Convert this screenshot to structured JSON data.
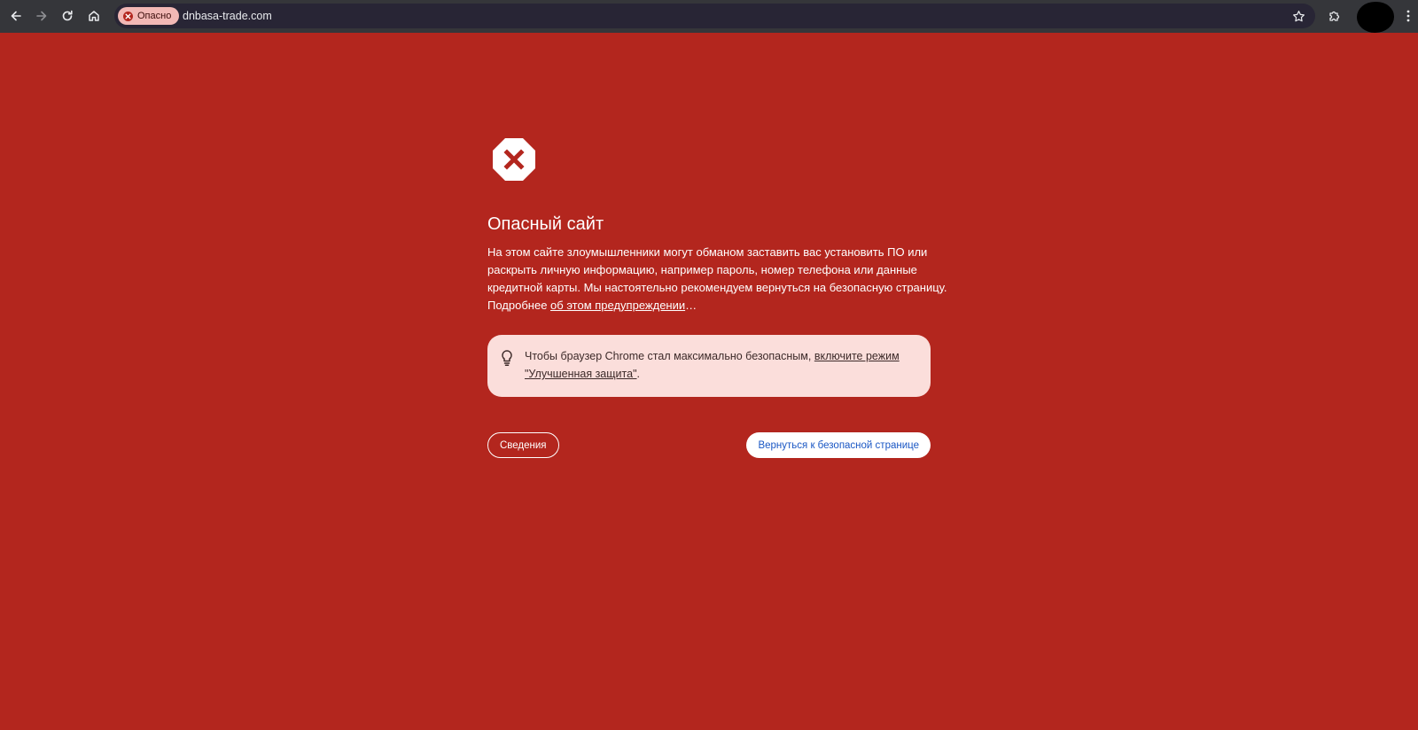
{
  "toolbar": {
    "back_icon": "arrow-left-icon",
    "forward_icon": "arrow-right-icon",
    "reload_icon": "reload-icon",
    "home_icon": "home-icon",
    "security_chip_label": "Опасно",
    "url": "dnbasa-trade.com",
    "bookmark_icon": "star-icon",
    "extensions_icon": "puzzle-icon",
    "menu_icon": "kebab-menu-icon"
  },
  "interstitial": {
    "icon": "dangerous-site-icon",
    "heading": "Опасный сайт",
    "message": {
      "line1": "На этом сайте злоумышленники могут обманом заставить вас установить ПО или",
      "line2": "раскрыть личную информацию, например пароль, номер телефона или данные",
      "line3": "кредитной карты. Мы настоятельно рекомендуем вернуться на безопасную страницу.",
      "learn_more_prefix": "Подробнее ",
      "learn_more_link": "об этом предупреждении",
      "learn_more_suffix": "…"
    },
    "promo": {
      "icon": "lightbulb-icon",
      "text_prefix": "Чтобы браузер Chrome стал максимально безопасным, ",
      "link_line1": "включите режим",
      "link_line2": "\"Улучшенная защита\"",
      "text_suffix": "."
    },
    "details_button": "Сведения",
    "back_button": "Вернуться к безопасной странице"
  },
  "colors": {
    "page_background": "#b3261e",
    "toolbar_background": "#35363a",
    "omnibox_background": "#282535",
    "security_chip": "#f2b8b5",
    "promo_background": "#fbdedb",
    "primary_button_text": "#1a57c4"
  }
}
